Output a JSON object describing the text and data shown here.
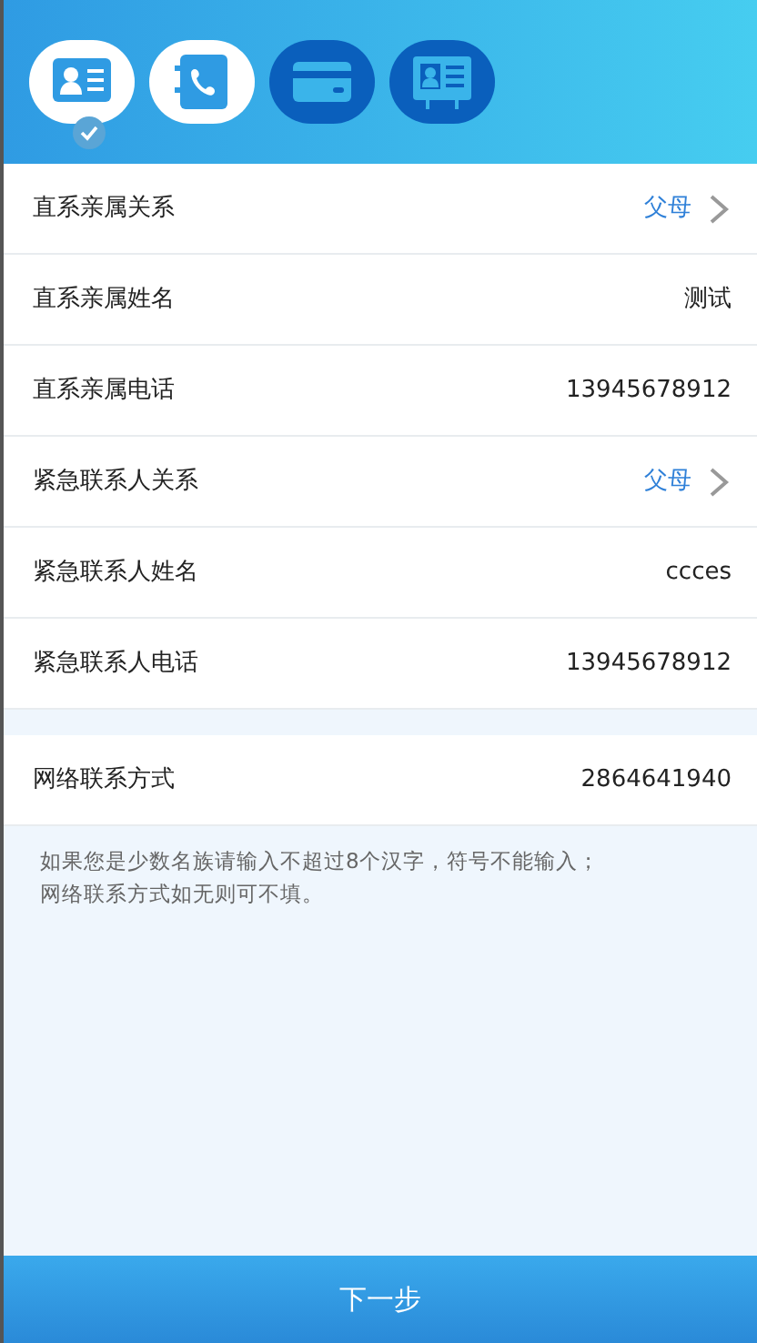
{
  "steps": [
    {
      "kind": "contact-card",
      "active": true,
      "completed": true
    },
    {
      "kind": "phone-book",
      "active": true,
      "completed": false
    },
    {
      "kind": "bank-card",
      "active": false,
      "completed": false
    },
    {
      "kind": "id-card",
      "active": false,
      "completed": false
    }
  ],
  "rows": [
    {
      "label": "直系亲属关系",
      "value": "父母",
      "kind": "select"
    },
    {
      "label": "直系亲属姓名",
      "value": "测试",
      "kind": "text"
    },
    {
      "label": "直系亲属电话",
      "value": "13945678912",
      "kind": "text"
    },
    {
      "label": "紧急联系人关系",
      "value": "父母",
      "kind": "select"
    },
    {
      "label": "紧急联系人姓名",
      "value": "ccces",
      "kind": "text"
    },
    {
      "label": "紧急联系人电话",
      "value": "13945678912",
      "kind": "text"
    }
  ],
  "network_row": {
    "label": "网络联系方式",
    "value": "2864641940"
  },
  "notes": [
    "如果您是少数名族请输入不超过8个汉字，符号不能输入；",
    "网络联系方式如无则可不填。"
  ],
  "next_button": "下一步"
}
